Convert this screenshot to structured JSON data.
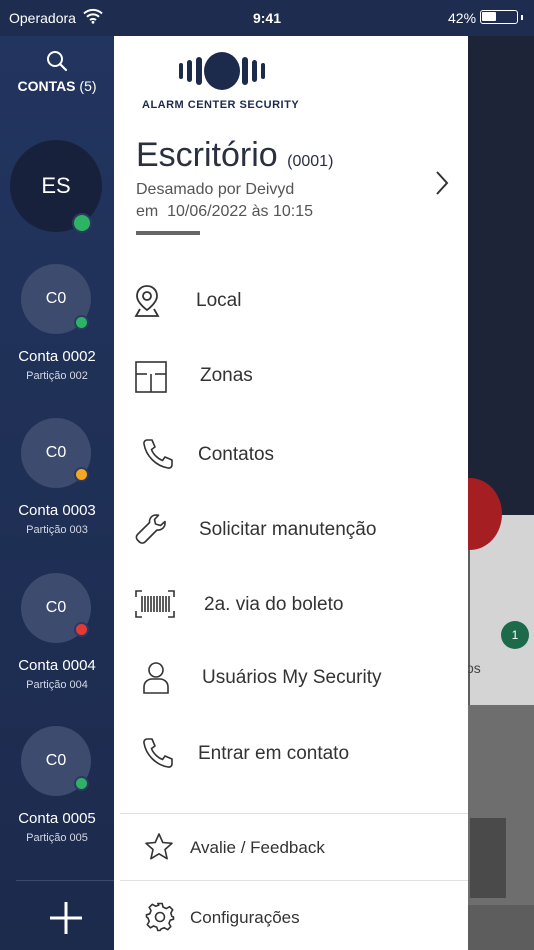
{
  "status_bar": {
    "carrier": "Operadora",
    "time": "9:41",
    "battery": "42%",
    "battery_level": 0.42
  },
  "rail": {
    "title": "CONTAS",
    "count": "(5)",
    "main_account": {
      "initials": "ES",
      "status_color": "#2eb365"
    },
    "accounts": [
      {
        "initials": "C0",
        "name": "Conta 0002",
        "partition": "Partição 002",
        "status_color": "#2eb365"
      },
      {
        "initials": "C0",
        "name": "Conta 0003",
        "partition": "Partição 003",
        "status_color": "#f5a623"
      },
      {
        "initials": "C0",
        "name": "Conta 0004",
        "partition": "Partição 004",
        "status_color": "#e53935"
      },
      {
        "initials": "C0",
        "name": "Conta 0005",
        "partition": "Partição 005",
        "status_color": "#2eb365"
      }
    ]
  },
  "drawer": {
    "logo_text": "ALARM CENTER SECURITY",
    "account_name": "Escritório",
    "account_code": "(0001)",
    "status_line1": "Desamado por Deivyd",
    "status_line2": "em  10/06/2022 às 10:15",
    "menu": [
      {
        "label": "Local",
        "icon": "location-pin-icon"
      },
      {
        "label": "Zonas",
        "icon": "floor-plan-icon"
      },
      {
        "label": "Contatos",
        "icon": "phone-icon"
      },
      {
        "label": "Solicitar manutenção",
        "icon": "wrench-icon"
      },
      {
        "label": "2a. via do boleto",
        "icon": "barcode-icon"
      },
      {
        "label": "Usuários My Security",
        "icon": "user-icon"
      },
      {
        "label": "Entrar em contato",
        "icon": "phone-icon"
      }
    ],
    "footer": [
      {
        "label": "Avalie / Feedback",
        "icon": "star-icon"
      },
      {
        "label": "Configurações",
        "icon": "gear-icon"
      }
    ]
  },
  "background": {
    "badge_count": "1",
    "partial_text": "os"
  }
}
